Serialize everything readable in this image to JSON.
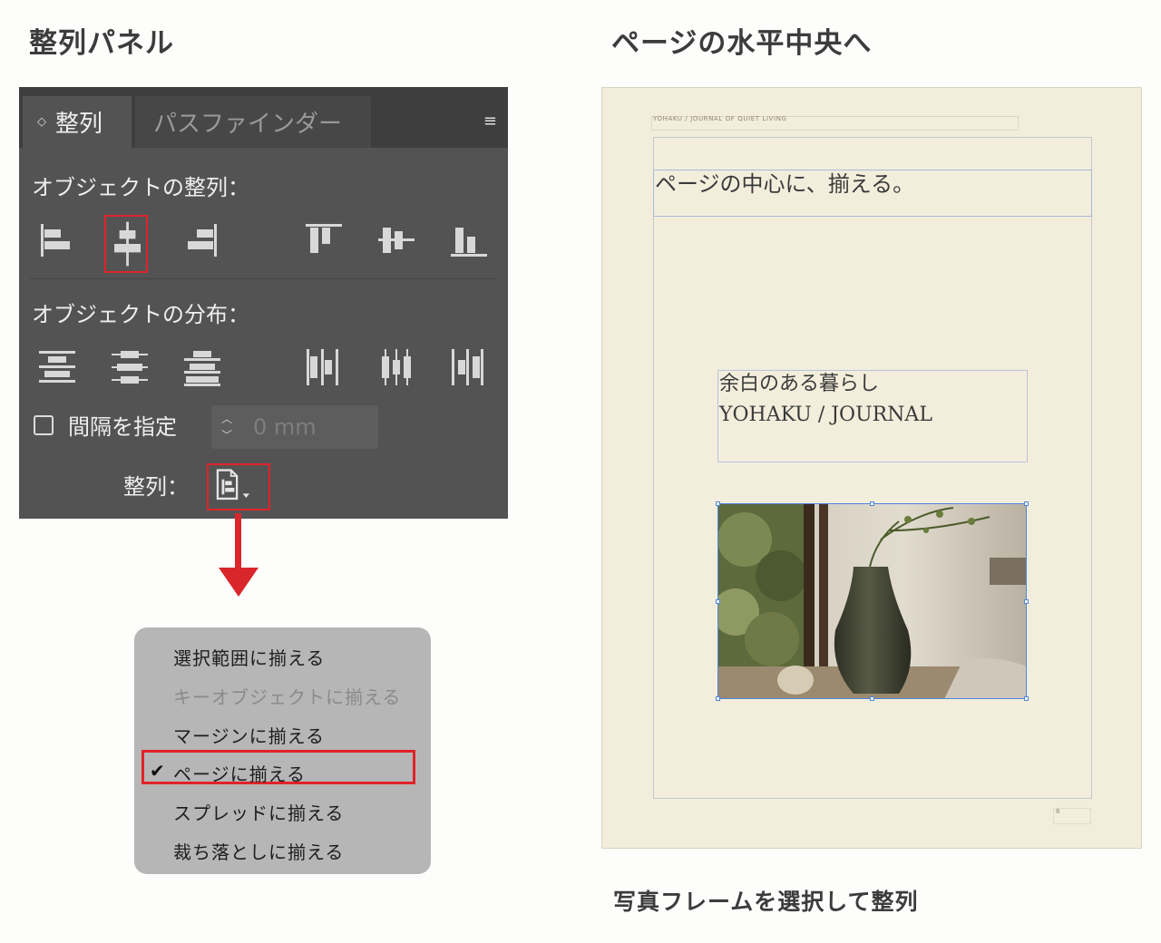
{
  "headings": {
    "left": "整列パネル",
    "right": "ページの水平中央へ",
    "caption": "写真フレームを選択して整列"
  },
  "panel": {
    "tabs": [
      {
        "label": "整列",
        "active": true
      },
      {
        "label": "パスファインダー",
        "active": false
      }
    ],
    "align_objects_label": "オブジェクトの整列：",
    "distribute_objects_label": "オブジェクトの分布：",
    "spacing_checkbox_label": "間隔を指定",
    "spacing_checked": false,
    "spacing_value": "0 mm",
    "align_to_label": "整列：",
    "align_buttons": [
      "align-left",
      "align-horizontal-center",
      "align-right",
      "align-top",
      "align-vertical-center",
      "align-bottom"
    ],
    "selected_align_button": "align-horizontal-center",
    "distribute_buttons": [
      "distribute-top",
      "distribute-vertical-center",
      "distribute-bottom",
      "distribute-left",
      "distribute-horizontal-center",
      "distribute-right"
    ]
  },
  "dropdown": {
    "items": [
      {
        "label": "選択範囲に揃える",
        "enabled": true,
        "checked": false
      },
      {
        "label": "キーオブジェクトに揃える",
        "enabled": false,
        "checked": false
      },
      {
        "label": "マージンに揃える",
        "enabled": true,
        "checked": false
      },
      {
        "label": "ページに揃える",
        "enabled": true,
        "checked": true
      },
      {
        "label": "スプレッドに揃える",
        "enabled": true,
        "checked": false
      },
      {
        "label": "裁ち落としに揃える",
        "enabled": true,
        "checked": false
      }
    ]
  },
  "document": {
    "header": "YOHAKU  /  JOURNAL OF QUIET LIVING",
    "title": "ページの中心に、揃える。",
    "text_line1": "余白のある暮らし",
    "text_line2": "YOHAKU  /  JOURNAL",
    "page_number": "8"
  },
  "colors": {
    "accent_red": "#e0232a",
    "panel_bg": "#535353",
    "page_bg": "#f3eedc"
  }
}
